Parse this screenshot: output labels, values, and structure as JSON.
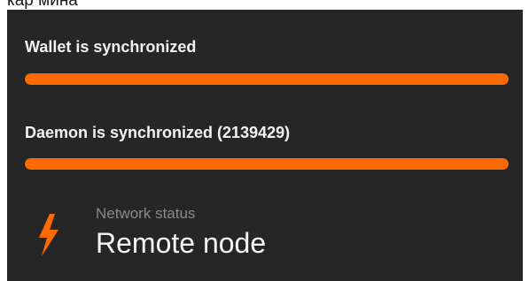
{
  "header": {
    "text": "кар мина"
  },
  "status": {
    "wallet_label": "Wallet is synchronized",
    "wallet_progress": 1.0,
    "daemon_label": "Daemon is synchronized (2139429)",
    "daemon_progress": 1.0
  },
  "network": {
    "caption": "Network status",
    "value": "Remote node",
    "icon": "lightning-bolt-icon"
  },
  "colors": {
    "panel_background": "#262626",
    "accent": "#ff6b00",
    "text_primary": "#f2f2f2",
    "text_secondary": "#8a8a8a"
  }
}
